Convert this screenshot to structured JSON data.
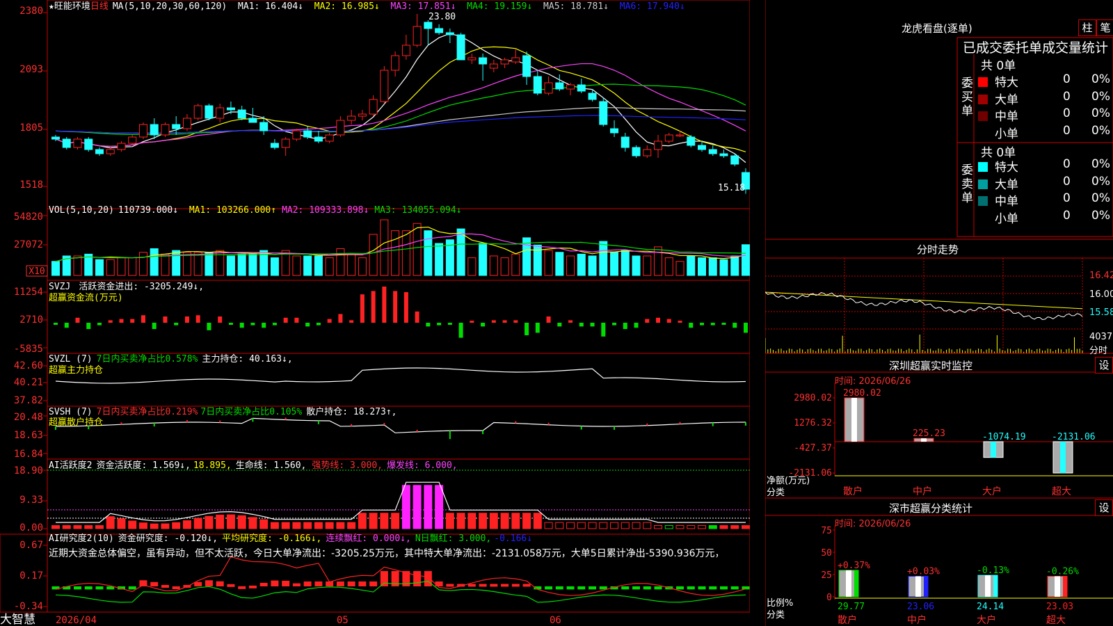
{
  "colors": {
    "up": "#ff2222",
    "down": "#22ffff",
    "ma1": "#ffffff",
    "ma2": "#ffff00",
    "ma3": "#ff44ff",
    "ma4": "#00dd00",
    "ma5": "#cccccc",
    "ma6": "#2222ff",
    "grid": "#cc0000",
    "axisText": "#ff3030"
  },
  "app": {
    "brand": "大智慧",
    "date_label": "2026/04",
    "month_may": "05",
    "month_jun": "06"
  },
  "main": {
    "title": "★旺能环境",
    "period": "日线",
    "ma_params": "MA(5,10,20,30,60,120)",
    "ma": [
      {
        "label": "MA1: 16.404↓",
        "color": "#ffffff"
      },
      {
        "label": "MA2: 16.985↓",
        "color": "#ffff00"
      },
      {
        "label": "MA3: 17.851↓",
        "color": "#ff44ff"
      },
      {
        "label": "MA4: 19.159↓",
        "color": "#00dd00"
      },
      {
        "label": "MA5: 18.781↓",
        "color": "#cccccc"
      },
      {
        "label": "MA6: 17.940↓",
        "color": "#2222ff"
      }
    ],
    "yticks": [
      "2380",
      "2093",
      "1805",
      "1518"
    ],
    "high_label": "23.80",
    "low_label": "15.18"
  },
  "chart_data": [
    {
      "type": "candlestick",
      "title": "旺能环境 日线",
      "ylim": [
        15.0,
        24.0
      ],
      "ohlc": [
        [
          17.9,
          18.0,
          17.7,
          17.8
        ],
        [
          17.8,
          17.9,
          17.3,
          17.4
        ],
        [
          17.4,
          17.9,
          17.3,
          17.8
        ],
        [
          17.8,
          17.9,
          17.2,
          17.3
        ],
        [
          17.3,
          17.4,
          17.0,
          17.1
        ],
        [
          17.1,
          17.4,
          17.0,
          17.3
        ],
        [
          17.3,
          17.7,
          17.2,
          17.6
        ],
        [
          17.6,
          18.0,
          17.5,
          17.9
        ],
        [
          17.9,
          18.6,
          17.8,
          18.5
        ],
        [
          18.5,
          18.8,
          17.8,
          18.0
        ],
        [
          18.0,
          18.6,
          17.9,
          18.5
        ],
        [
          18.5,
          18.9,
          18.0,
          18.3
        ],
        [
          18.3,
          19.0,
          18.2,
          18.8
        ],
        [
          18.8,
          19.5,
          18.7,
          19.4
        ],
        [
          19.4,
          19.5,
          18.7,
          18.8
        ],
        [
          18.8,
          19.5,
          18.6,
          19.3
        ],
        [
          19.3,
          19.6,
          19.0,
          19.2
        ],
        [
          19.2,
          19.4,
          18.7,
          18.8
        ],
        [
          18.8,
          19.3,
          18.6,
          18.6
        ],
        [
          18.6,
          18.9,
          18.0,
          18.2
        ],
        [
          17.6,
          17.8,
          17.3,
          17.4
        ],
        [
          17.4,
          17.9,
          17.0,
          17.8
        ],
        [
          17.8,
          18.3,
          17.7,
          18.2
        ],
        [
          18.2,
          18.4,
          17.8,
          17.9
        ],
        [
          17.9,
          18.2,
          17.6,
          17.7
        ],
        [
          17.7,
          18.1,
          17.6,
          18.0
        ],
        [
          18.0,
          18.9,
          17.9,
          18.7
        ],
        [
          18.7,
          19.2,
          18.5,
          18.9
        ],
        [
          18.9,
          19.2,
          18.7,
          19.0
        ],
        [
          19.0,
          19.9,
          18.9,
          19.7
        ],
        [
          19.6,
          21.3,
          19.5,
          21.1
        ],
        [
          21.1,
          22.0,
          20.8,
          21.8
        ],
        [
          21.8,
          22.8,
          21.6,
          22.3
        ],
        [
          22.3,
          23.8,
          22.2,
          23.2
        ],
        [
          23.4,
          23.5,
          22.3,
          23.1
        ],
        [
          23.1,
          23.3,
          22.8,
          22.9
        ],
        [
          22.9,
          23.1,
          22.4,
          22.8
        ],
        [
          22.8,
          22.9,
          21.6,
          21.6
        ],
        [
          21.6,
          21.9,
          21.4,
          21.7
        ],
        [
          21.7,
          21.9,
          20.6,
          21.4
        ],
        [
          21.2,
          21.6,
          21.0,
          21.4
        ],
        [
          21.4,
          21.7,
          21.2,
          21.6
        ],
        [
          21.5,
          22.1,
          21.4,
          21.7
        ],
        [
          21.8,
          22.0,
          20.4,
          20.8
        ],
        [
          20.8,
          21.1,
          19.9,
          20.0
        ],
        [
          20.0,
          20.8,
          19.9,
          20.5
        ],
        [
          20.5,
          20.9,
          20.1,
          20.2
        ],
        [
          20.2,
          20.5,
          19.9,
          20.4
        ],
        [
          20.4,
          20.7,
          20.0,
          20.1
        ],
        [
          20.0,
          20.2,
          19.6,
          19.7
        ],
        [
          19.6,
          19.8,
          18.4,
          18.5
        ],
        [
          18.3,
          18.7,
          17.9,
          18.1
        ],
        [
          17.9,
          18.1,
          17.2,
          17.4
        ],
        [
          17.4,
          17.5,
          16.9,
          17.0
        ],
        [
          17.0,
          17.5,
          16.9,
          17.3
        ],
        [
          17.3,
          18.0,
          16.9,
          17.7
        ],
        [
          17.7,
          18.1,
          17.6,
          18.0
        ],
        [
          18.0,
          18.2,
          17.9,
          18.0
        ],
        [
          17.9,
          18.0,
          17.4,
          17.5
        ],
        [
          17.5,
          17.7,
          17.2,
          17.3
        ],
        [
          17.3,
          17.5,
          17.0,
          17.1
        ],
        [
          17.1,
          17.3,
          16.9,
          17.0
        ],
        [
          17.0,
          17.1,
          16.5,
          16.6
        ],
        [
          16.2,
          16.4,
          15.18,
          15.4
        ]
      ]
    }
  ],
  "vol": {
    "header": "VOL(5,10,20)",
    "value": "110739.000↓",
    "ma1": "MA1: 103266.000↑",
    "ma2": "MA2: 109333.898↓",
    "ma3": "MA3: 134055.094↓",
    "yticks": [
      "54820",
      "27072"
    ],
    "unit": "X10"
  },
  "svzj": {
    "header": "SVZJ",
    "line": "活跃资金进出: -3205.249↓,",
    "sub": "超赢资金流(万元)",
    "yticks": [
      "11254",
      "2710",
      "-5835"
    ]
  },
  "svzl": {
    "header": "SVZL (7)",
    "p1": "7日内买卖净占比0.578%",
    "p2": "主力持仓: 40.163↓,",
    "sub": "超赢主力持仓",
    "yticks": [
      "42.60",
      "40.21",
      "37.82"
    ]
  },
  "svsh": {
    "header": "SVSH (7)",
    "p1": "7日内买卖净占比0.219%",
    "p2": "7日内买卖净占比0.105%",
    "p3": "散户持仓: 18.273↑,",
    "sub": "超赢散户持仓",
    "yticks": [
      "20.48",
      "18.63",
      "16.84"
    ]
  },
  "ai1": {
    "header": "AI活跃度2",
    "a": "资金活跃度: 1.569↓,",
    "b": "18.895,",
    "c": "生命线: 1.560,",
    "d": "强势线: 3.000,",
    "e": "爆发线: 6.000,",
    "yticks": [
      "18.90",
      "9.33",
      "0.00"
    ]
  },
  "ai2": {
    "header": "AI研究度2(10)",
    "a": "资金研究度: -0.120↓,",
    "b": "平均研究度: -0.166↓,",
    "c": "连续飘红: 0.000↓,",
    "d": "N日飘红: 3.000,",
    "e": "-0.166↓",
    "summary": "近期大资金总体偏空，虽有异动，但不太活跃，今日大单净流出：-3205.25万元，其中特大单净流出：-2131.058万元，大单5日累计净出-5390.936万元，",
    "yticks": [
      "0.67",
      "0.17",
      "-0.34"
    ]
  },
  "right": {
    "lhb_title": "龙虎看盘(逐单)",
    "btn_zhu": "柱",
    "btn_bi": "笔",
    "stats_title": "已成交委托单成交量统计",
    "buy_total": "共 0单",
    "sell_total": "共 0单",
    "buy_side": "委买单",
    "sell_side": "委卖单",
    "buy_rows": [
      {
        "name": "特大",
        "n": "0",
        "p": "0%",
        "c": "#ff0000"
      },
      {
        "name": "大单",
        "n": "0",
        "p": "0%",
        "c": "#a00000"
      },
      {
        "name": "中单",
        "n": "0",
        "p": "0%",
        "c": "#700000"
      },
      {
        "name": "小单",
        "n": "0",
        "p": "0%",
        "c": "#000000"
      }
    ],
    "sell_rows": [
      {
        "name": "特大",
        "n": "0",
        "p": "0%",
        "c": "#00ffff"
      },
      {
        "name": "大单",
        "n": "0",
        "p": "0%",
        "c": "#00a0a0"
      },
      {
        "name": "中单",
        "n": "0",
        "p": "0%",
        "c": "#007070"
      },
      {
        "name": "小单",
        "n": "0",
        "p": "0%",
        "c": "#000000"
      }
    ],
    "fenshi_title": "分时走势",
    "fenshi_y": [
      "16.42",
      "16.00",
      "15.58"
    ],
    "fenshi_vol": "4037",
    "fenshi_unit": "分时",
    "sz_title": "深圳超赢实时监控",
    "btn_set": "设",
    "sz_time": "时间: 2026/06/26",
    "sz_ylabels": [
      "2980.02",
      "1276.32",
      "-427.37",
      "-2131.06"
    ],
    "sz_vals": [
      {
        "cat": "散户",
        "v": 2980.02,
        "lbl": "2980.02"
      },
      {
        "cat": "中户",
        "v": 225.23,
        "lbl": "225.23"
      },
      {
        "cat": "大户",
        "v": -1074.19,
        "lbl": "-1074.19"
      },
      {
        "cat": "超大",
        "v": -2131.06,
        "lbl": "-2131.06"
      }
    ],
    "sz_axis_label": "净额(万元)",
    "sz_axis_cat": "分类",
    "cls_title": "深市超赢分类统计",
    "cls_time": "时间: 2026/06/26",
    "cls_yticks": [
      "75",
      "50",
      "25",
      "0"
    ],
    "cls_vals": [
      {
        "cat": "散户",
        "v": 29.77,
        "chg": "+0.37%",
        "c": "#00dd00",
        "lbl": "29.77"
      },
      {
        "cat": "中户",
        "v": 23.06,
        "chg": "+0.03%",
        "c": "#2222ff",
        "lbl": "23.06"
      },
      {
        "cat": "大户",
        "v": 24.14,
        "chg": "-0.13%",
        "c": "#22ffff",
        "lbl": "24.14"
      },
      {
        "cat": "超大",
        "v": 23.03,
        "chg": "-0.26%",
        "c": "#ff2222",
        "lbl": "23.03"
      }
    ],
    "cls_axis_label": "比例%",
    "cls_axis_cat": "分类"
  }
}
